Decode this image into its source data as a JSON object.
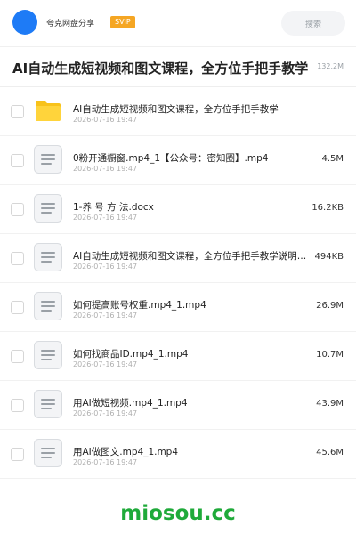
{
  "header": {
    "share_name": "夸克网盘分享",
    "badge": "SVIP",
    "search_placeholder": "搜索"
  },
  "title": {
    "text": "AI自动生成短视频和图文课程，全方位手把手教学",
    "total_size": "132.2M"
  },
  "colors": {
    "avatar": "#1e7bf6",
    "badge": "#f5a623",
    "folder": "#f8c21a",
    "watermark": "#1faa3a"
  },
  "files": [
    {
      "type": "folder-icon",
      "name": "AI自动生成短视频和图文课程，全方位手把手教学",
      "date": "2026-07-16 19:47",
      "size": ""
    },
    {
      "type": "document-icon",
      "name": "0粉开通橱窗.mp4_1【公众号：密知圈】.mp4",
      "date": "2026-07-16 19:47",
      "size": "4.5M"
    },
    {
      "type": "document-icon",
      "name": "1-养 号 方 法.docx",
      "date": "2026-07-16 19:47",
      "size": "16.2KB"
    },
    {
      "type": "document-icon",
      "name": "AI自动生成短视频和图文课程，全方位手把手教学说明…",
      "date": "2026-07-16 19:47",
      "size": "494KB"
    },
    {
      "type": "document-icon",
      "name": "如何提高账号权重.mp4_1.mp4",
      "date": "2026-07-16 19:47",
      "size": "26.9M"
    },
    {
      "type": "document-icon",
      "name": "如何找商品ID.mp4_1.mp4",
      "date": "2026-07-16 19:47",
      "size": "10.7M"
    },
    {
      "type": "document-icon",
      "name": "用AI做短视频.mp4_1.mp4",
      "date": "2026-07-16 19:47",
      "size": "43.9M"
    },
    {
      "type": "document-icon",
      "name": "用AI做图文.mp4_1.mp4",
      "date": "2026-07-16 19:47",
      "size": "45.6M"
    }
  ],
  "footer": {
    "watermark": "miosou.cc"
  }
}
